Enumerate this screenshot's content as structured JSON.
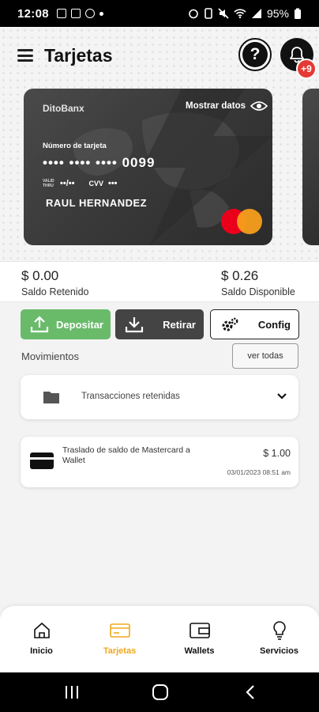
{
  "status_bar": {
    "time": "12:08",
    "battery": "95%"
  },
  "header": {
    "title": "Tarjetas",
    "help_label": "?",
    "notification_badge": "+9"
  },
  "card": {
    "bank_name": "DitoBanx",
    "show_data_label": "Mostrar datos",
    "number_label": "Número de tarjeta",
    "masked_number": "•••• •••• •••• 0099",
    "valid_thru_label": "VALID THRU",
    "expiry": "••/••",
    "cvv_label": "CVV",
    "cvv": "•••",
    "holder": "RAUL HERNANDEZ",
    "brand_icon": "mastercard-logo"
  },
  "balances": {
    "retained_amount": "$ 0.00",
    "retained_label": "Saldo Retenido",
    "available_amount": "$ 0.26",
    "available_label": "Saldo Disponible"
  },
  "actions": {
    "deposit_label": "Depositar",
    "withdraw_label": "Retirar",
    "config_label": "Config",
    "deposit_color": "#69bb6a"
  },
  "movements": {
    "title": "Movimientos",
    "see_all_label": "ver todas",
    "retained_label": "Transacciones retenidas",
    "transactions": [
      {
        "description": "Traslado de saldo de Mastercard a Wallet",
        "amount": "$ 1.00",
        "date": "03/01/2023 08:51 am"
      }
    ]
  },
  "bottom_nav": {
    "items": [
      {
        "label": "Inicio",
        "icon": "home-icon"
      },
      {
        "label": "Tarjetas",
        "icon": "card-icon"
      },
      {
        "label": "Wallets",
        "icon": "wallet-icon"
      },
      {
        "label": "Servicios",
        "icon": "lightbulb-icon"
      }
    ],
    "active_color": "#f0a81c"
  }
}
